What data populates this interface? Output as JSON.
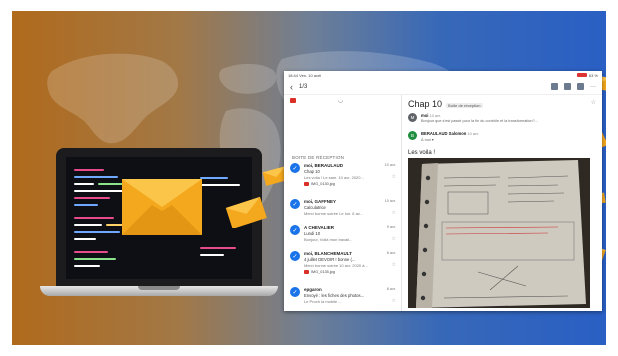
{
  "colors": {
    "accent": "#1a73e8",
    "envelope": "#f4a81d",
    "envelope_dark": "#d98a0e"
  },
  "tablet": {
    "statusbar": {
      "time": "18:44  Ven. 10 avril",
      "indicators": "63 %"
    },
    "topbar": {
      "count": "1/3",
      "back_icon": "back-arrow",
      "dots": "···"
    },
    "list": {
      "section_label": "BOITE DE RÉCEPTION",
      "items": [
        {
          "sender": "moi, BERAULAUD",
          "subject": "Chap 10",
          "snippet": "Les voila ! Le sam. 10 avr. 2020...",
          "time": "10 avr.",
          "attachment": "IMG_0130.jpg"
        },
        {
          "sender": "moi, GAFFNEY",
          "subject": "Calculatrice",
          "snippet": "Merci bonne soirée Le lun. 6 av...",
          "time": "10 avr.",
          "attachment": ""
        },
        {
          "sender": "A CHEVALIER",
          "subject": "Lundi 10",
          "snippet": "Bonjour, Voilà mon travail...",
          "time": "9 avr.",
          "attachment": ""
        },
        {
          "sender": "moi, BLANCHEMAULT",
          "subject": "4 juillet DEVOIR ! bonne (...",
          "snippet": "Merci bonne soirée 10 avr. 2020 à...",
          "time": "8 avr.",
          "attachment": "IMG_0135.jpg"
        },
        {
          "sender": "epgaron",
          "subject": "Envoyé : les fiches des photos...",
          "snippet": "Le Proch la mobile ...",
          "time": "8 avr.",
          "attachment": ""
        }
      ]
    },
    "reader": {
      "subject": "Chap 10",
      "label": "Boîte de réception",
      "thread": [
        {
          "initial": "M",
          "who": "moi",
          "when": "10 avr.",
          "snippet": "Bonjour que s'est passé pour la fin du contrôle et la transformation?..."
        },
        {
          "initial": "B",
          "who": "BERAULAUD Salomon",
          "when": "10 avr.",
          "snippet": "À moi ▾"
        }
      ],
      "greeting": "Les voila !"
    }
  }
}
